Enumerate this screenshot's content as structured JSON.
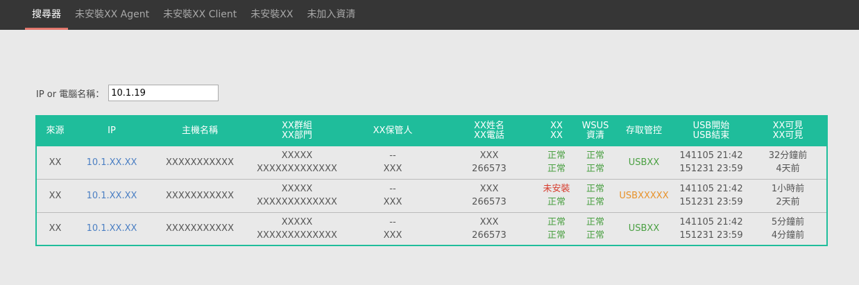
{
  "nav": {
    "items": [
      {
        "label": "搜尋器",
        "active": true
      },
      {
        "label": "未安裝XX Agent",
        "active": false
      },
      {
        "label": "未安裝XX Client",
        "active": false
      },
      {
        "label": "未安裝XX",
        "active": false
      },
      {
        "label": "未加入資清",
        "active": false
      }
    ]
  },
  "search": {
    "label": "IP or 電腦名稱：",
    "value": "10.1.19"
  },
  "table": {
    "headers": [
      [
        "來源"
      ],
      [
        "IP"
      ],
      [
        "主機名稱"
      ],
      [
        "XX群組",
        "XX部門"
      ],
      [
        "XX保管人"
      ],
      [
        "XX姓名",
        "XX電話"
      ],
      [
        "XX",
        "XX"
      ],
      [
        "WSUS",
        "資清"
      ],
      [
        "存取管控"
      ],
      [
        "USB開始",
        "USB結束"
      ],
      [
        "XX可見",
        "XX可見"
      ]
    ],
    "rows": [
      {
        "source": "XX",
        "ip": "10.1.XX.XX",
        "host": "XXXXXXXXXXX",
        "group": "XXXXX",
        "dept": "XXXXXXXXXXXXX",
        "custodian1": "--",
        "custodian2": "XXX",
        "name": "XXX",
        "phone": "266573",
        "xx1": "正常",
        "xx2": "正常",
        "wsus1": "正常",
        "wsus2": "正常",
        "access": "USBXX",
        "usb_start": "141105 21:42",
        "usb_end": "151231 23:59",
        "seen1": "32分鐘前",
        "seen2": "4天前"
      },
      {
        "source": "XX",
        "ip": "10.1.XX.XX",
        "host": "XXXXXXXXXXX",
        "group": "XXXXX",
        "dept": "XXXXXXXXXXXXX",
        "custodian1": "--",
        "custodian2": "XXX",
        "name": "XXX",
        "phone": "266573",
        "xx1": "未安裝",
        "xx2": "正常",
        "wsus1": "正常",
        "wsus2": "正常",
        "access": "USBXXXXX",
        "usb_start": "141105 21:42",
        "usb_end": "151231 23:59",
        "seen1": "1小時前",
        "seen2": "2天前"
      },
      {
        "source": "XX",
        "ip": "10.1.XX.XX",
        "host": "XXXXXXXXXXX",
        "group": "XXXXX",
        "dept": "XXXXXXXXXXXXX",
        "custodian1": "--",
        "custodian2": "XXX",
        "name": "XXX",
        "phone": "266573",
        "xx1": "正常",
        "xx2": "正常",
        "wsus1": "正常",
        "wsus2": "正常",
        "access": "USBXX",
        "usb_start": "141105 21:42",
        "usb_end": "151231 23:59",
        "seen1": "5分鐘前",
        "seen2": "4分鐘前"
      }
    ]
  }
}
